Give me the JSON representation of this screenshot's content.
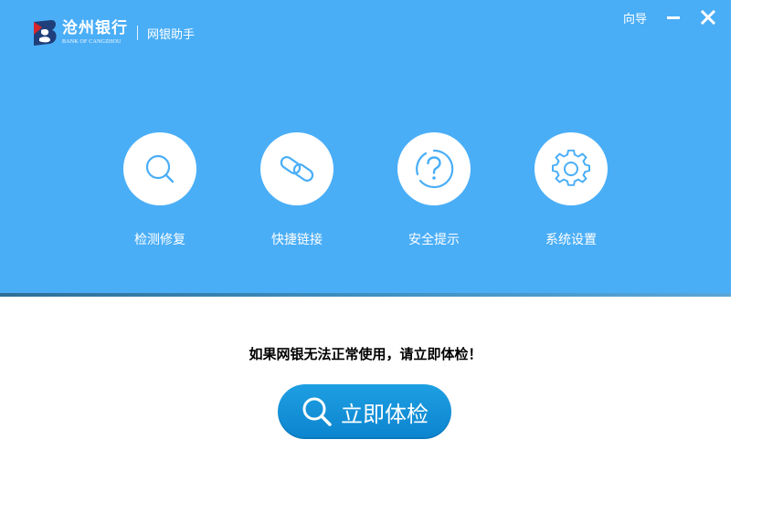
{
  "window": {
    "logo_cn": "沧州银行",
    "logo_en": "BANK OF CANGZHOU",
    "subtitle": "网银助手",
    "guide": "向导"
  },
  "features": [
    {
      "label": "检测修复",
      "icon": "search-icon"
    },
    {
      "label": "快捷链接",
      "icon": "link-icon"
    },
    {
      "label": "安全提示",
      "icon": "help-icon"
    },
    {
      "label": "系统设置",
      "icon": "gear-icon"
    }
  ],
  "main": {
    "prompt": "如果网银无法正常使用，请立即体检！",
    "check_button": "立即体检"
  },
  "colors": {
    "header_bg": "#4aaef7",
    "icon_blue": "#4aaef7",
    "button_bg": "#1296dc"
  }
}
